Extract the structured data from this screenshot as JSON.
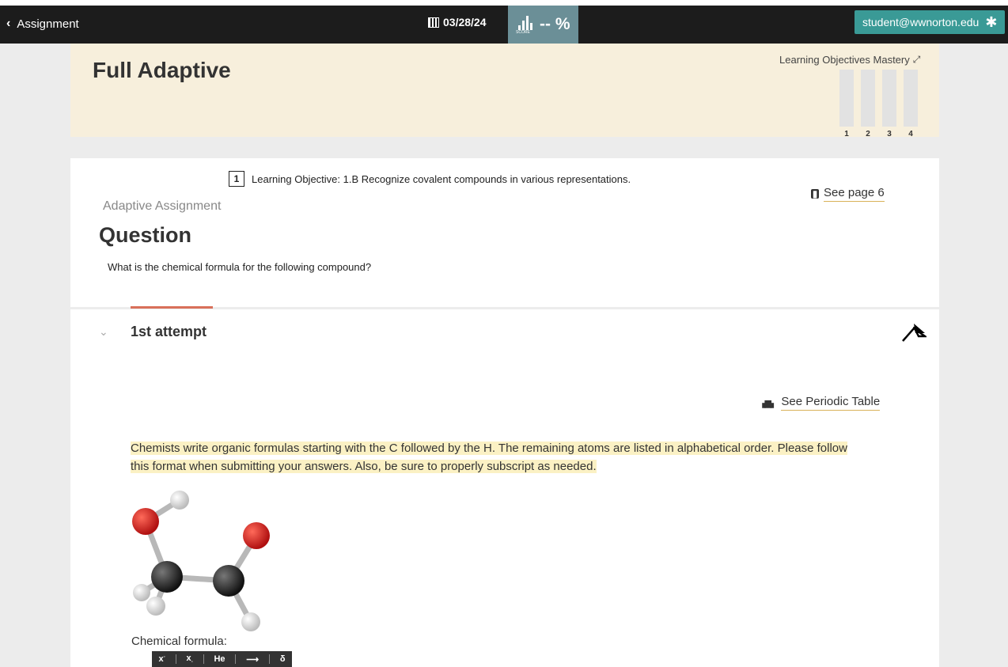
{
  "topbar": {
    "back_label": "Assignment",
    "date": "03/28/24",
    "score_label": "SCORE",
    "score_value": "-- %",
    "user_email": "student@wwnorton.edu"
  },
  "header": {
    "title": "Full Adaptive",
    "mastery_title": "Learning Objectives Mastery",
    "mastery_numbers": [
      "1",
      "2",
      "3",
      "4"
    ]
  },
  "question": {
    "lo_number": "1",
    "lo_text": "Learning Objective: 1.B Recognize covalent compounds in various representations.",
    "see_page": "See page 6",
    "adaptive_label": "Adaptive Assignment",
    "heading": "Question",
    "text": "What is the chemical formula for the following compound?"
  },
  "attempt": {
    "title": "1st attempt",
    "periodic_link": "See Periodic Table",
    "instructions": "Chemists write organic formulas starting with the C followed by the H. The remaining atoms are listed in alphabetical order. Please follow this format when submitting your answers. Also, be sure to properly subscript as needed.",
    "formula_label": "Chemical formula:",
    "toolbar": {
      "superscript": "x",
      "subscript": "x",
      "element": "He",
      "arrow": "⟶",
      "delta": "δ"
    }
  },
  "colors": {
    "topbar": "#1c1c1c",
    "score_bg": "#6b8f97",
    "user_btn": "#3a9a96",
    "header_bg": "#f7efdc",
    "highlight": "#fbf1c4",
    "accent_tab": "#d9705a"
  }
}
